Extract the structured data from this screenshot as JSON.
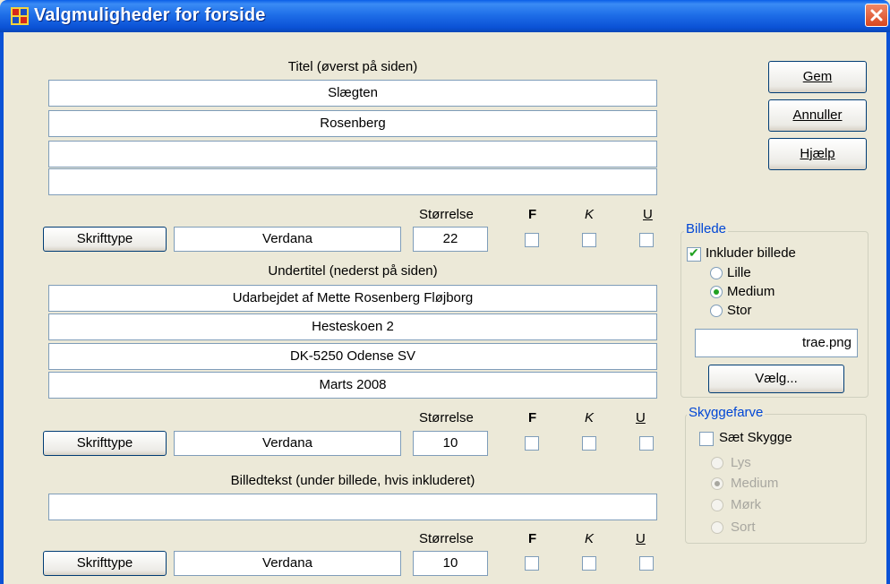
{
  "window": {
    "title": "Valgmuligheder for forside"
  },
  "buttons": {
    "save": "Gem",
    "cancel": "Annuller",
    "help": "Hjælp",
    "choose": "Vælg..."
  },
  "title_section": {
    "label": "Titel (øverst på siden)",
    "lines": [
      "Slægten",
      "Rosenberg",
      "",
      ""
    ],
    "font_button": "Skrifttype",
    "font_name": "Verdana",
    "size_label": "Størrelse",
    "size": "22",
    "bold_label": "F",
    "italic_label": "K",
    "underline_label": "U"
  },
  "subtitle_section": {
    "label": "Undertitel (nederst på siden)",
    "lines": [
      "Udarbejdet af Mette Rosenberg Fløjborg",
      "Hesteskoen 2",
      "DK-5250 Odense SV",
      "Marts 2008"
    ],
    "font_button": "Skrifttype",
    "font_name": "Verdana",
    "size_label": "Størrelse",
    "size": "10",
    "bold_label": "F",
    "italic_label": "K",
    "underline_label": "U"
  },
  "caption_section": {
    "label": "Billedtekst (under billede, hvis inkluderet)",
    "line": "",
    "font_button": "Skrifttype",
    "font_name": "Verdana",
    "size_label": "Størrelse",
    "size": "10",
    "bold_label": "F",
    "italic_label": "K",
    "underline_label": "U"
  },
  "image_group": {
    "title": "Billede",
    "include_label": "Inkluder billede",
    "include_checked": true,
    "sizes": [
      "Lille",
      "Medium",
      "Stor"
    ],
    "selected_size": "Medium",
    "filename": "trae.png"
  },
  "shadow_group": {
    "title": "Skyggefarve",
    "set_shadow_label": "Sæt Skygge",
    "set_shadow_checked": false,
    "options": [
      "Lys",
      "Medium",
      "Mørk",
      "Sort"
    ],
    "selected": "Medium"
  },
  "colors": {
    "titlebar": "#0b52d6",
    "dialog_bg": "#ece9d8",
    "group_title": "#0046d5",
    "close_button": "#d8461e"
  }
}
